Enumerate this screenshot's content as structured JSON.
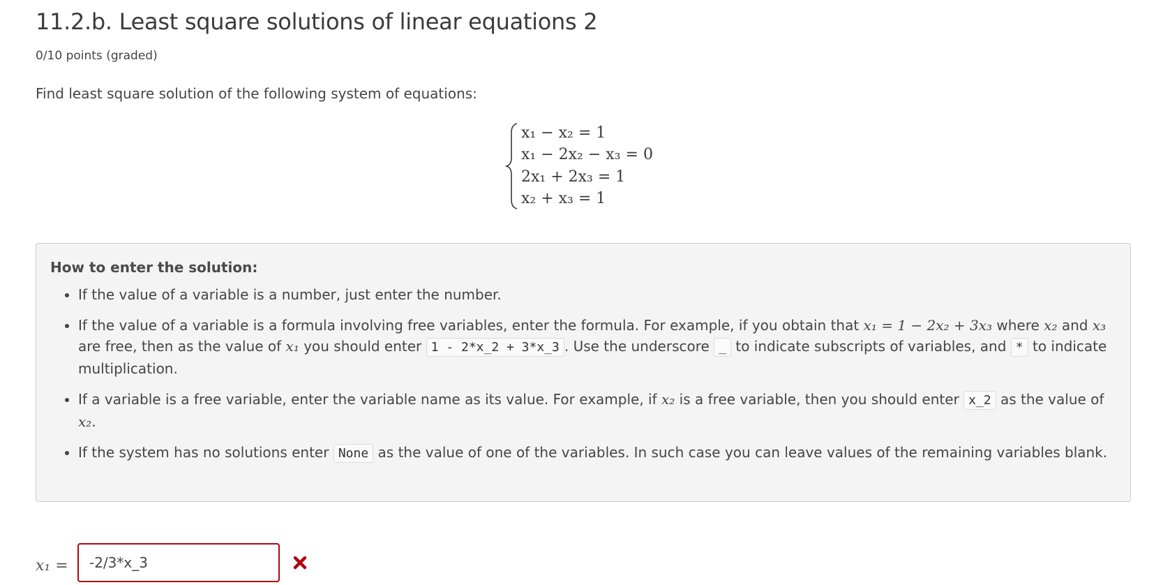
{
  "header": {
    "title": "11.2.b. Least square solutions of linear equations 2",
    "points": "0/10 points (graded)"
  },
  "problem": {
    "intro": "Find least square solution of the following system of equations:",
    "equations": [
      {
        "lhs": "x₁ − x₂",
        "rhs": "= 1"
      },
      {
        "lhs": "x₁ − 2x₂ − x₃",
        "rhs": "= 0"
      },
      {
        "lhs": "2x₁ + 2x₃",
        "rhs": "= 1"
      },
      {
        "lhs": "x₂ + x₃",
        "rhs": "= 1"
      }
    ]
  },
  "help": {
    "title": "How to enter the solution:",
    "item1": "If the value of a variable is a number, just enter the number.",
    "item2": {
      "a": "If the value of a variable is a formula involving free variables, enter the formula. For example, if you obtain that ",
      "math1": "x₁ = 1 − 2x₂ + 3x₃",
      "b": " where ",
      "math2": "x₂",
      "c": " and ",
      "math3": "x₃",
      "d": " are free, then as the value of ",
      "math4": "x₁",
      "e": " you should enter ",
      "code1": "1 - 2*x_2 + 3*x_3",
      "f": ". Use the underscore ",
      "code2": "_",
      "g": " to indicate subscripts of variables, and ",
      "code3": "*",
      "h": " to indicate multiplication."
    },
    "item3": {
      "a": "If a variable is a free variable, enter the variable name as its value. For example, if ",
      "math1": "x₂",
      "b": " is a free variable, then you should enter ",
      "code1": "x_2",
      "c": " as the value of ",
      "math2": "x₂",
      "d": "."
    },
    "item4": {
      "a": "If the system has no solutions enter ",
      "code1": "None",
      "b": " as the value of one of the variables. In such case you can leave values of the remaining variables blank."
    }
  },
  "answer": {
    "label": "x₁ =",
    "value": "-2/3*x_3",
    "status_icon": "incorrect-x-icon",
    "status_color": "#b20610"
  }
}
